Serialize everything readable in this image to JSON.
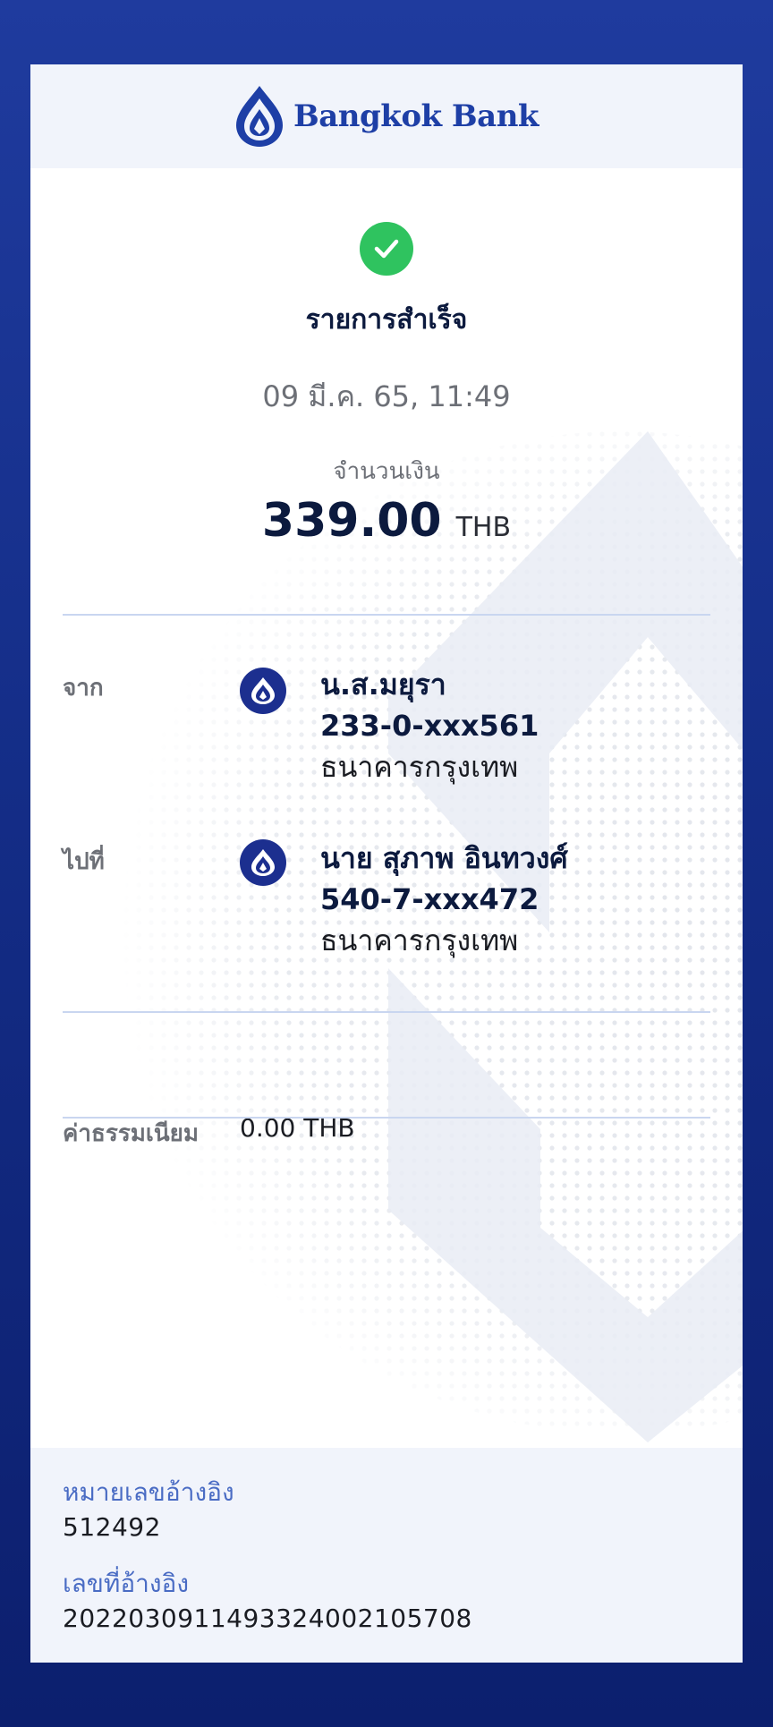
{
  "header": {
    "brand_name": "Bangkok Bank",
    "logo_icon": "bangkok-bank-lotus-logo"
  },
  "status": {
    "icon": "check-circle-icon",
    "title": "รายการสำเร็จ",
    "datetime": "09 มี.ค. 65, 11:49"
  },
  "amount": {
    "label": "จำนวนเงิน",
    "value": "339.00",
    "currency": "THB"
  },
  "from": {
    "label": "จาก",
    "icon": "bangkok-bank-icon",
    "name": "น.ส.มยุรา",
    "account": "233-0-xxx561",
    "bank": "ธนาคารกรุงเทพ"
  },
  "to": {
    "label": "ไปที่",
    "icon": "bangkok-bank-icon",
    "name": "นาย สุภาพ อินทวงศ์",
    "account": "540-7-xxx472",
    "bank": "ธนาคารกรุงเทพ"
  },
  "fee": {
    "label": "ค่าธรรมเนียม",
    "value": "0.00 THB"
  },
  "footer": {
    "ref_number_label": "หมายเลขอ้างอิง",
    "ref_number": "512492",
    "ref_id_label": "เลขที่อ้างอิง",
    "ref_id": "2022030911493324002105708"
  },
  "colors": {
    "background": "#142d87",
    "brand_blue": "#1e3fa6",
    "success_green": "#2fc35f",
    "ref_label_blue": "#4a6cc4"
  }
}
